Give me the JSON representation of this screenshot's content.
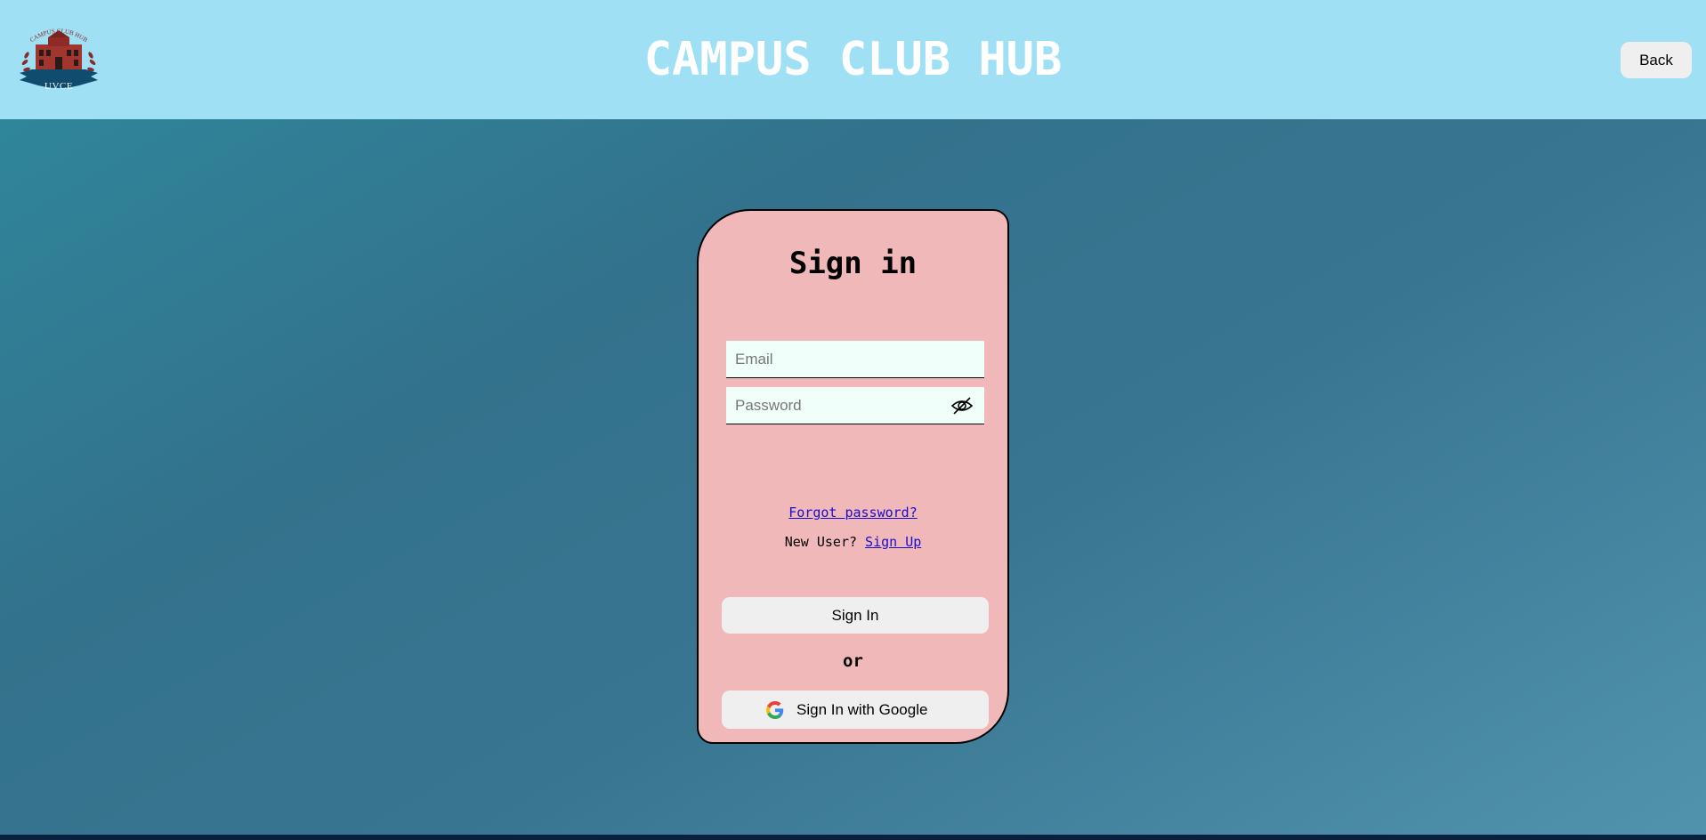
{
  "header": {
    "logo_text": "UVCE",
    "logo_arc_text": "CAMPUS CLUB HUB",
    "site_title": "CAMPUS CLUB HUB",
    "back_label": "Back"
  },
  "signin": {
    "title": "Sign in",
    "email_placeholder": "Email",
    "password_placeholder": "Password",
    "forgot_label": "Forgot password?",
    "new_user_text": "New User?",
    "signup_label": "Sign Up",
    "signin_button": "Sign In",
    "or_text": "or",
    "google_button": "Sign In with Google"
  },
  "icons": {
    "eye": "eye-slash-icon",
    "google": "google-icon"
  },
  "colors": {
    "header_bg": "#9fe0f4",
    "card_bg": "#f0b8b9",
    "input_bg": "#f0fff9",
    "link": "#1a0dcc",
    "footer": "#0b1f3f"
  }
}
